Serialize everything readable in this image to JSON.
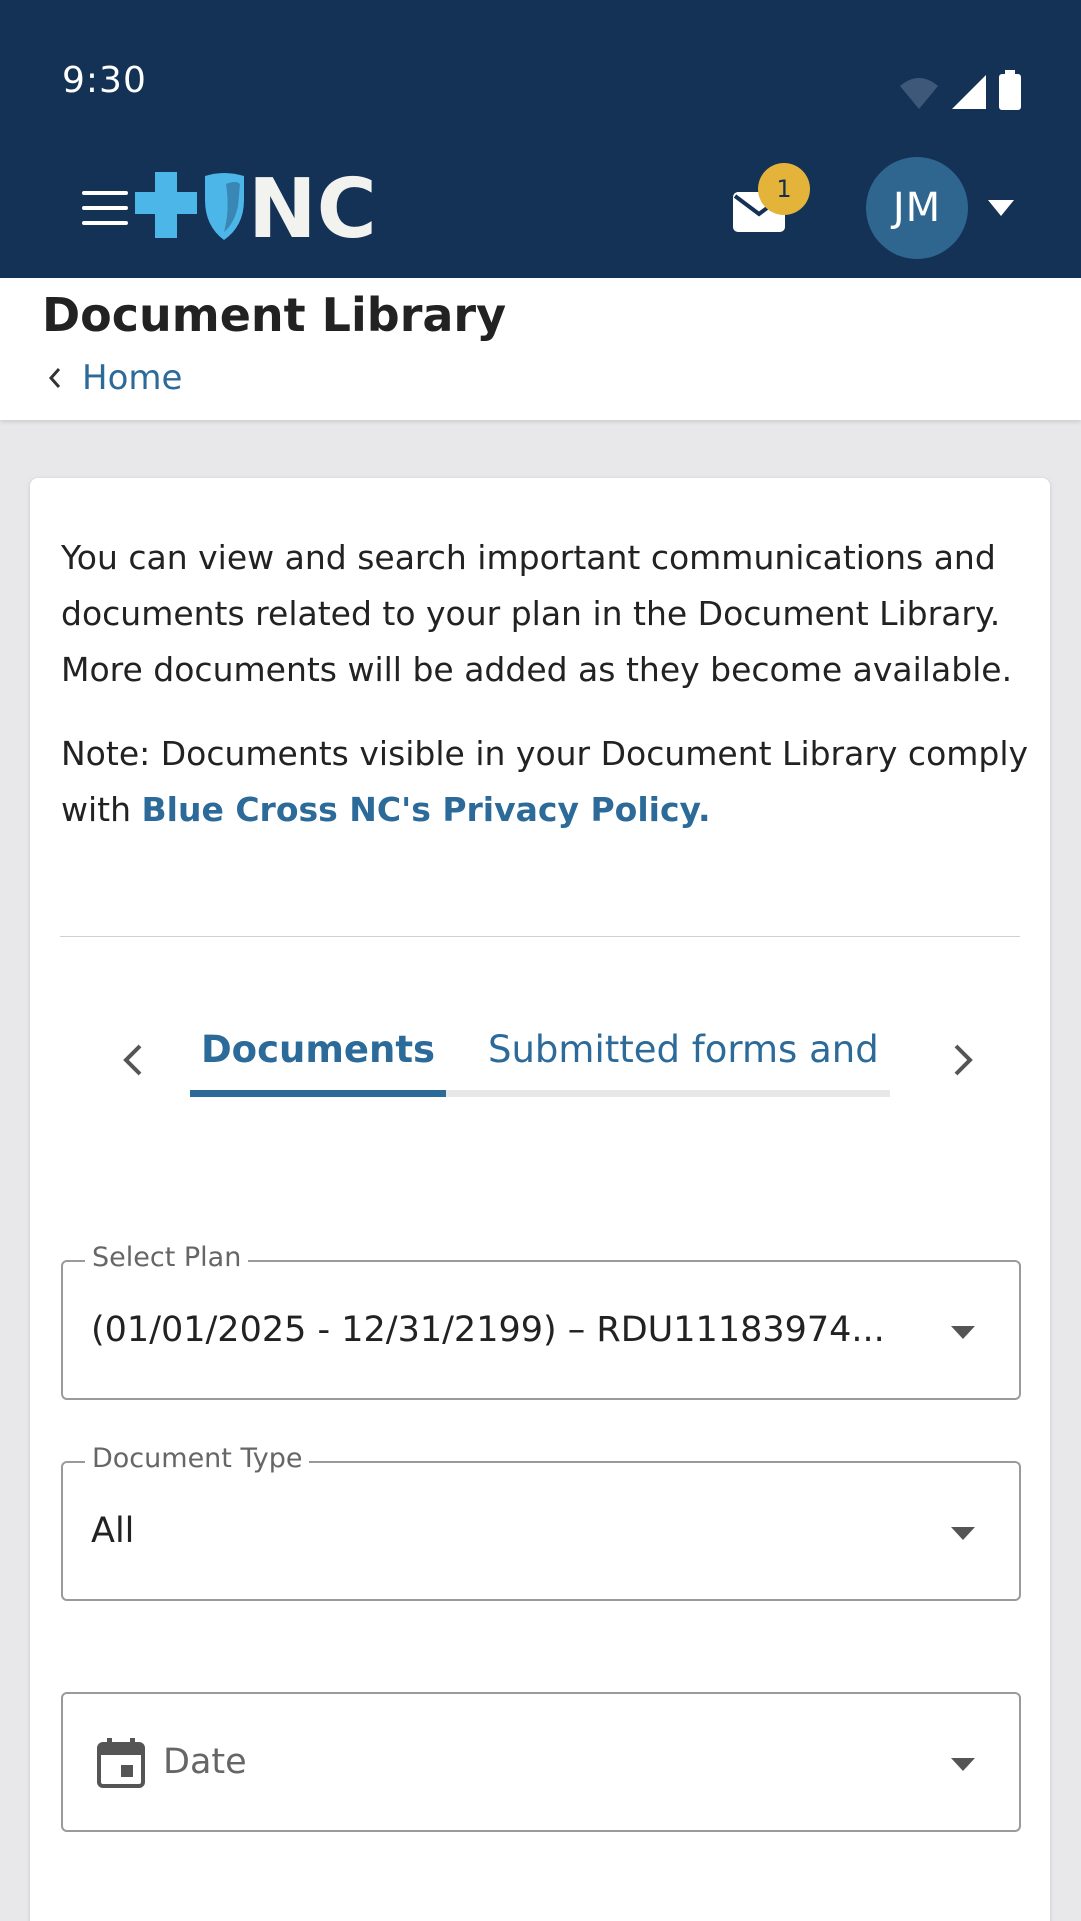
{
  "status_bar": {
    "time": "9:30"
  },
  "app_bar": {
    "logo_text": "NC",
    "notification_count": "1",
    "avatar_initials": "JM"
  },
  "header": {
    "title": "Document Library",
    "breadcrumb": "Home"
  },
  "content": {
    "intro": "You can view and search important communications and documents related to your plan in the Document Library. More documents will be added as they become available.",
    "note_prefix": "Note: Documents visible in your Document Library comply with ",
    "note_link": "Blue Cross NC's Privacy Policy."
  },
  "tabs": [
    {
      "label": "Documents",
      "selected": true
    },
    {
      "label": "Submitted forms and di",
      "selected": false
    }
  ],
  "filters": {
    "plan": {
      "label": "Select Plan",
      "value": "(01/01/2025 - 12/31/2199) – RDU11183974..."
    },
    "doc_type": {
      "label": "Document Type",
      "value": "All"
    },
    "date": {
      "placeholder": "Date"
    }
  },
  "colors": {
    "app_bar": "#133256",
    "accent": "#2c6a99",
    "logo_blue": "#4db6e8",
    "badge": "#e4b43a",
    "avatar": "#2e6690"
  },
  "icons": [
    "wifi-icon",
    "signal-icon",
    "battery-icon",
    "menu-icon",
    "cross-icon",
    "shield-icon",
    "mail-icon",
    "caret-down-icon",
    "chevron-left-icon",
    "chevron-right-icon",
    "calendar-icon"
  ]
}
